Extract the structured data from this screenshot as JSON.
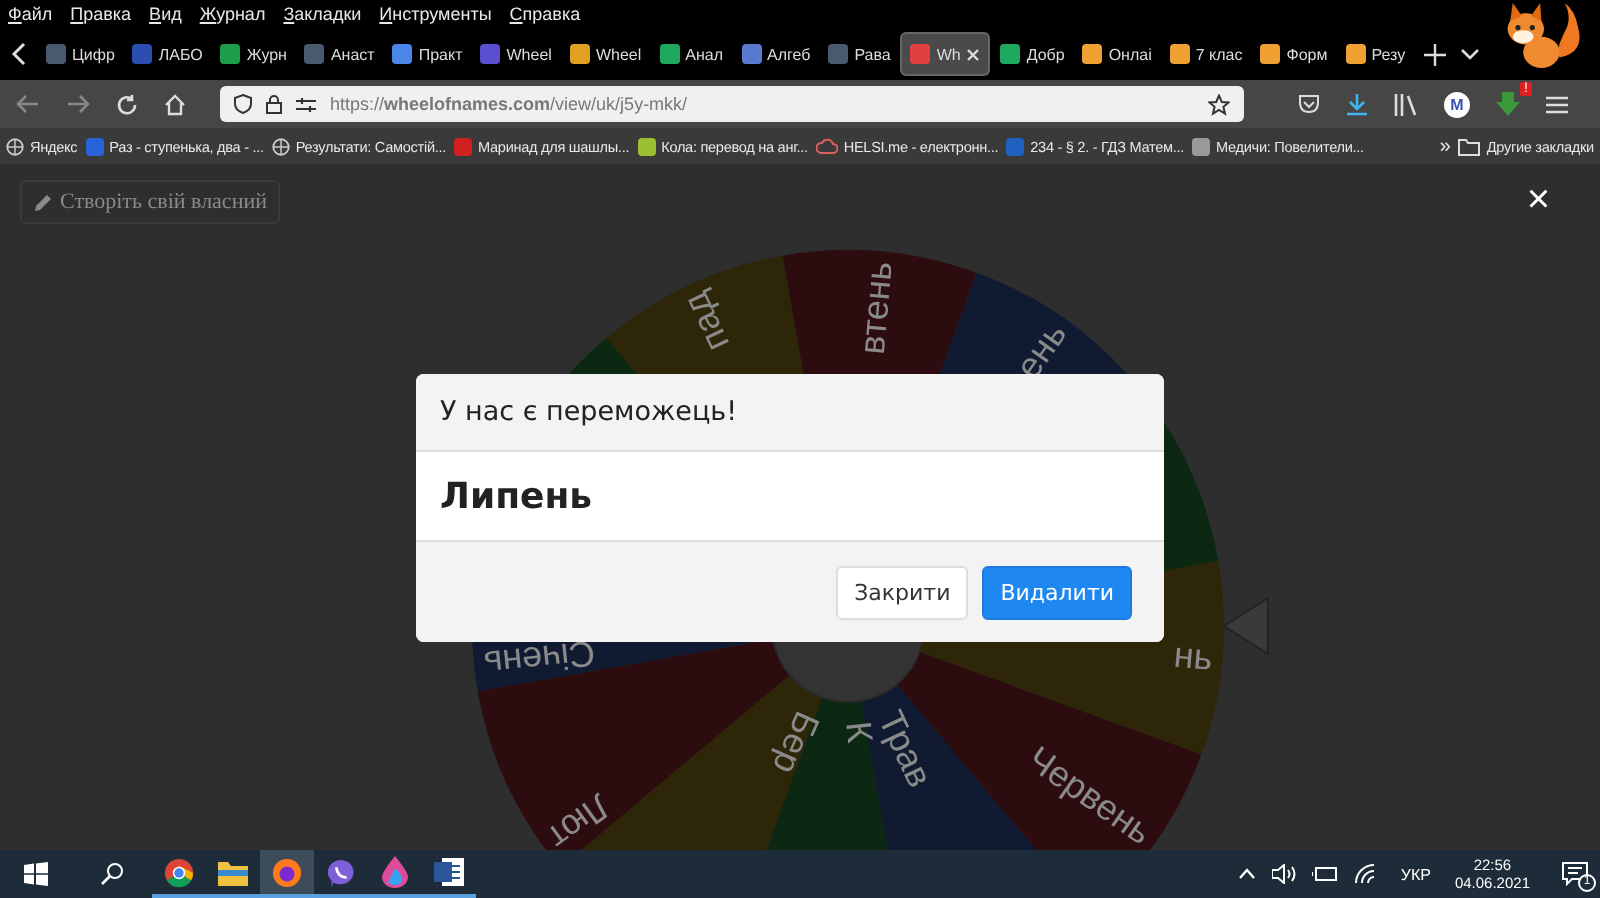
{
  "menu_bar": [
    "Файл",
    "Правка",
    "Вид",
    "Журнал",
    "Закладки",
    "Инструменты",
    "Справка"
  ],
  "tabs": [
    {
      "label": "Цифр",
      "selected": false,
      "color": "#4a5a6e"
    },
    {
      "label": "ЛАБО",
      "selected": false,
      "color": "#2a4fb0"
    },
    {
      "label": "Журн",
      "selected": false,
      "color": "#1e9e4a"
    },
    {
      "label": "Анаст",
      "selected": false,
      "color": "#4a5a6e"
    },
    {
      "label": "Практ",
      "selected": false,
      "color": "#4a86e8"
    },
    {
      "label": "Wheel",
      "selected": false,
      "color": "#5b4fd0"
    },
    {
      "label": "Wheel",
      "selected": false,
      "color": "#e0a020"
    },
    {
      "label": "Анал",
      "selected": false,
      "color": "#1ea860"
    },
    {
      "label": "Алгеб",
      "selected": false,
      "color": "#5a7ad0"
    },
    {
      "label": "Рава",
      "selected": false,
      "color": "#4a5a6e"
    },
    {
      "label": "Wh",
      "selected": true,
      "color": "#e04040"
    },
    {
      "label": "Добр",
      "selected": false,
      "color": "#1ea860"
    },
    {
      "label": "Онлаі",
      "selected": false,
      "color": "#f0a030"
    },
    {
      "label": "7 клас",
      "selected": false,
      "color": "#f0a030"
    },
    {
      "label": "Форм",
      "selected": false,
      "color": "#f0a030"
    },
    {
      "label": "Резу",
      "selected": false,
      "color": "#f0a030"
    }
  ],
  "url_bar": {
    "url": "https://**wheelofnames.com**/view/uk/j5y-mkk/"
  },
  "account_initial": "M",
  "extension_badge": "!",
  "bookmarks": [
    {
      "label": "Яндекс",
      "kind": "globe"
    },
    {
      "label": "Раз - ступенька, два - ...",
      "kind": "logo",
      "color": "#2a62d8"
    },
    {
      "label": "Результати: Самостій...",
      "kind": "globe"
    },
    {
      "label": "Маринад для шашлы...",
      "kind": "logo",
      "color": "#d02020"
    },
    {
      "label": "Кола: перевод на анг...",
      "kind": "logo",
      "color": "#9ac030"
    },
    {
      "label": "HELSI.me - електронн...",
      "kind": "cloud",
      "color": "#e06060"
    },
    {
      "label": "234 - § 2. - ГДЗ Матем...",
      "kind": "logo",
      "color": "#2060c0"
    },
    {
      "label": "Медичи: Повелители...",
      "kind": "logo",
      "color": "#999999"
    }
  ],
  "bookmarks_overflow": "»",
  "other_bookmarks": "Другие закладки",
  "page": {
    "create_button": "Створіть свій власний",
    "close": "×",
    "wheel": [
      {
        "label": "нь",
        "color": "#2e2608"
      },
      {
        "label": "Червень",
        "color": "#2c0c0e"
      },
      {
        "label": "Трав",
        "color": "#101a30"
      },
      {
        "label": "К",
        "color": "#0c2812"
      },
      {
        "label": "Бер",
        "color": "#2e2608"
      },
      {
        "label": "Лют",
        "color": "#2c0c0e"
      },
      {
        "label": "Січень",
        "color": "#101a30"
      },
      {
        "color": "#0c2812"
      },
      {
        "label": "пад",
        "color": "#2e2608"
      },
      {
        "label": "втень",
        "color": "#2c0c0e"
      },
      {
        "label": "ень",
        "color": "#101a30"
      },
      {
        "color": "#0c2812"
      }
    ]
  },
  "dialog": {
    "title": "У нас є переможець!",
    "winner": "Липень",
    "buttons": [
      {
        "label": "Закрити",
        "kind": "secondary"
      },
      {
        "label": "Видалити",
        "kind": "primary"
      }
    ]
  },
  "taskbar": {
    "apps": [
      {
        "kind": "chrome",
        "active": false
      },
      {
        "kind": "explorer",
        "active": false
      },
      {
        "kind": "firefox",
        "active": true
      },
      {
        "kind": "viber",
        "active": false
      },
      {
        "kind": "drop",
        "active": false
      },
      {
        "kind": "word",
        "active": false
      }
    ],
    "language": "УКР",
    "time": "22:56",
    "date": "04.06.2021",
    "notifications": "1"
  }
}
